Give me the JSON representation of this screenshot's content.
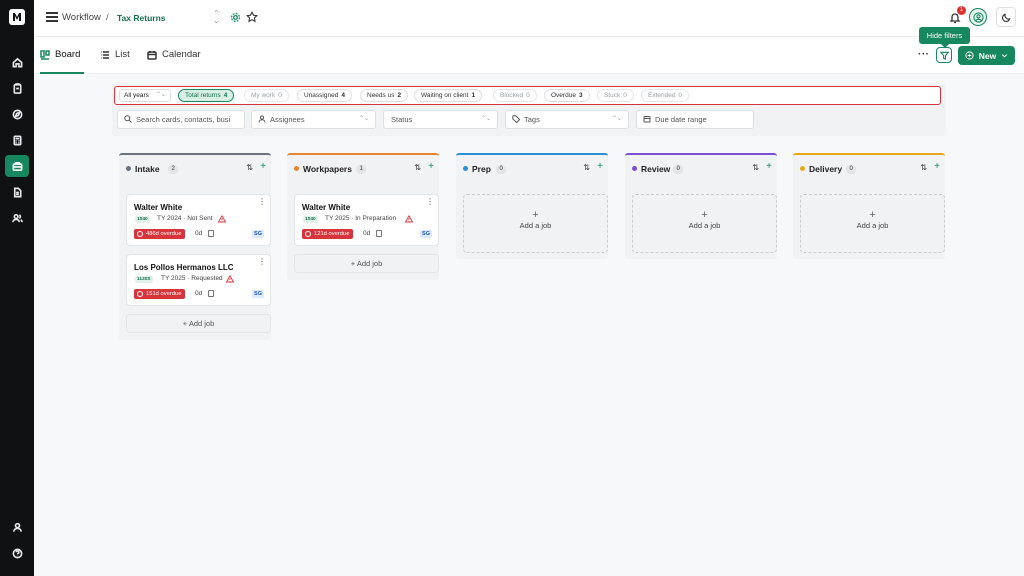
{
  "header": {
    "app_section": "Workflow",
    "separator": "/",
    "page": "Tax Returns",
    "notifications_count": "1"
  },
  "views": [
    {
      "label": "Board",
      "icon": "board-icon",
      "active": true
    },
    {
      "label": "List",
      "icon": "list-icon",
      "active": false
    },
    {
      "label": "Calendar",
      "icon": "calendar-icon",
      "active": false
    }
  ],
  "actions": {
    "more": "···",
    "filter_tooltip": "Hide filters",
    "new_label": "New"
  },
  "filters": {
    "year": "All years",
    "chips": [
      {
        "label": "Total returns",
        "count": "4",
        "state": "selected"
      },
      {
        "label": "My work",
        "count": "0",
        "state": "muted"
      },
      {
        "label": "Unassigned",
        "count": "4",
        "state": "normal"
      },
      {
        "label": "Needs us",
        "count": "2",
        "state": "normal"
      },
      {
        "label": "Waiting on client",
        "count": "1",
        "state": "normal"
      },
      {
        "label": "Blocked",
        "count": "0",
        "state": "muted"
      },
      {
        "label": "Overdue",
        "count": "3",
        "state": "normal"
      },
      {
        "label": "Stuck",
        "count": "0",
        "state": "muted"
      },
      {
        "label": "Extended",
        "count": "0",
        "state": "muted"
      }
    ],
    "search_placeholder": "Search cards, contacts, busi",
    "assignees": "Assignees",
    "status": "Status",
    "tags": "Tags",
    "due_date": "Due date range"
  },
  "columns": [
    {
      "title": "Intake",
      "count": "2",
      "color": "#6b7280",
      "cards": [
        {
          "client": "Walter White",
          "form": "1040",
          "status": "TY 2024 · Not Sent",
          "overdue": "486d overdue",
          "age": "0d",
          "assignee": "SG"
        },
        {
          "client": "Los Pollos Hermanos LLC",
          "form": "1120S",
          "status": "TY 2025 · Requested",
          "overdue": "151d overdue",
          "age": "0d",
          "assignee": "SG"
        }
      ],
      "add_label": "Add job"
    },
    {
      "title": "Workpapers",
      "count": "1",
      "color": "#e8852b",
      "cards": [
        {
          "client": "Walter White",
          "form": "1040",
          "status": "TY 2025 · In Preparation",
          "overdue": "121d overdue",
          "age": "0d",
          "assignee": "SG"
        }
      ],
      "add_label": "Add job"
    },
    {
      "title": "Prep",
      "count": "0",
      "color": "#2b8fd8",
      "cards": [],
      "empty_label": "Add a job"
    },
    {
      "title": "Review",
      "count": "0",
      "color": "#7b4fd6",
      "cards": [],
      "empty_label": "Add a job"
    },
    {
      "title": "Delivery",
      "count": "0",
      "color": "#e5a91a",
      "cards": [],
      "empty_label": "Add a job"
    }
  ]
}
